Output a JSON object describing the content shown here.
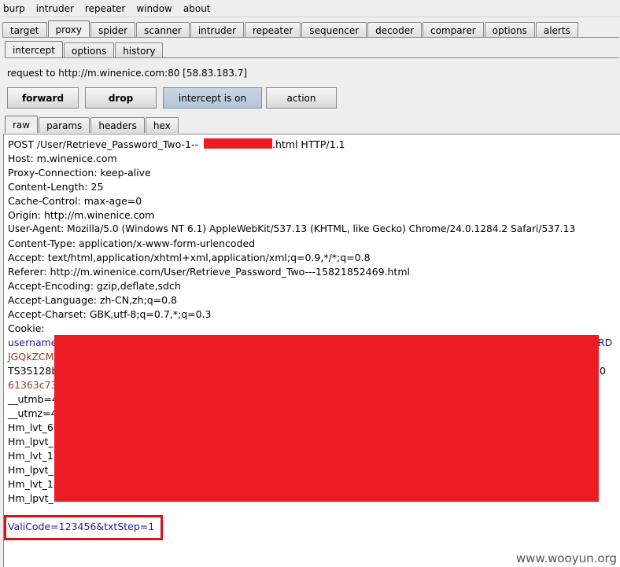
{
  "menu": [
    "burp",
    "intruder",
    "repeater",
    "window",
    "about"
  ],
  "main_tabs": [
    "target",
    "proxy",
    "spider",
    "scanner",
    "intruder",
    "repeater",
    "sequencer",
    "decoder",
    "comparer",
    "options",
    "alerts"
  ],
  "proxy_tabs": [
    "intercept",
    "options",
    "history"
  ],
  "request_label": "request to http://m.winenice.com:80  [58.83.183.7]",
  "buttons": {
    "forward": "forward",
    "drop": "drop",
    "intercept": "intercept is on",
    "action": "action"
  },
  "editor_tabs": [
    "raw",
    "params",
    "headers",
    "hex"
  ],
  "request_lines": {
    "l0a": "POST /User/Retrieve_Password_Two-1--",
    "l0b": ".html HTTP/1.1",
    "l1": "Host: m.winenice.com",
    "l2": "Proxy-Connection: keep-alive",
    "l3": "Content-Length: 25",
    "l4": "Cache-Control: max-age=0",
    "l5": "Origin: http://m.winenice.com",
    "l6": "User-Agent: Mozilla/5.0 (Windows NT 6.1) AppleWebKit/537.13 (KHTML, like Gecko) Chrome/24.0.1284.2 Safari/537.13",
    "l7": "Content-Type: application/x-www-form-urlencoded",
    "l8": "Accept: text/html,application/xhtml+xml,application/xml;q=0.9,*/*;q=0.8",
    "l9": "Referer: http://m.winenice.com/User/Retrieve_Password_Two---15821852469.html",
    "l10": "Accept-Encoding: gzip,deflate,sdch",
    "l11": "Accept-Language: zh-CN,zh;q=0.8",
    "l12": "Accept-Charset: GBK,utf-8;q=0.7,*;q=0.3",
    "l13": "Cookie:",
    "l14": "username",
    "l14r": "RD",
    "l15": "JGQkZCM",
    "l16": "TS35128b",
    "l16r": "0",
    "l17": "61363c73",
    "l18": "__utmb=4",
    "l19": "__utmz=4",
    "l20": "Hm_lvt_6",
    "l21": "Hm_lpvt_",
    "l22": "Hm_lvt_1",
    "l23": "Hm_lpvt_",
    "l24": "Hm_lvt_1",
    "l25": "Hm_lpvt_",
    "body": "ValiCode=123456&txtStep=1"
  },
  "watermark": "www.wooyun.org",
  "colors": {
    "redaction": "#ec1c24",
    "highlight_border": "#d8131b"
  }
}
